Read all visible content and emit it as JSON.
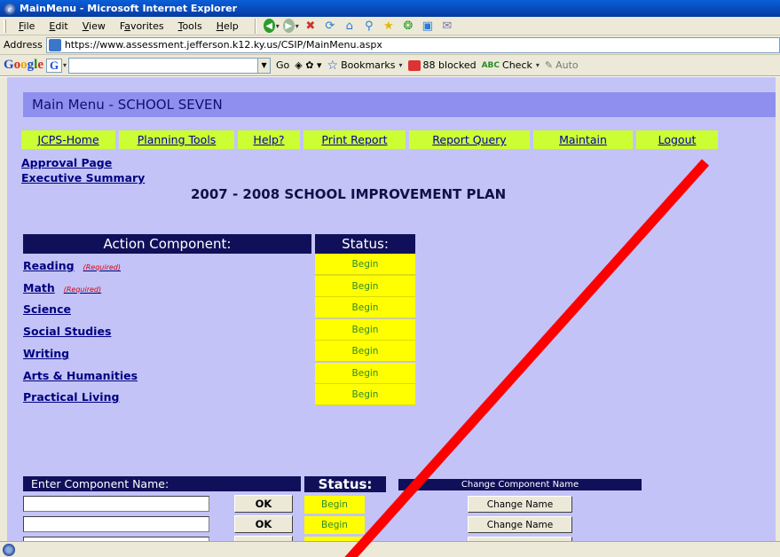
{
  "window": {
    "title": "MainMenu - Microsoft Internet Explorer"
  },
  "menubar": {
    "items": [
      {
        "label": "File",
        "ul": "F",
        "rest": "ile"
      },
      {
        "label": "Edit",
        "ul": "E",
        "rest": "dit"
      },
      {
        "label": "View",
        "ul": "V",
        "rest": "iew"
      },
      {
        "label": "Favorites",
        "pre": "F",
        "ul": "a",
        "rest": "vorites"
      },
      {
        "label": "Tools",
        "ul": "T",
        "rest": "ools"
      },
      {
        "label": "Help",
        "ul": "H",
        "rest": "elp"
      }
    ]
  },
  "address": {
    "label": "Address",
    "url": "https://www.assessment.jefferson.k12.ky.us/CSIP/MainMenu.aspx"
  },
  "google_toolbar": {
    "go": "Go",
    "bookmarks": "Bookmarks",
    "blocked": "88 blocked",
    "check": "Check",
    "autofill": "Auto"
  },
  "page": {
    "header": "Main Menu - SCHOOL SEVEN",
    "nav": [
      "JCPS-Home",
      "Planning Tools",
      "Help?",
      "Print Report",
      "Report Query",
      "Maintain",
      "Logout"
    ],
    "approval_link": "Approval Page",
    "exec_link": "Executive Summary",
    "plan_title": "2007 - 2008 SCHOOL IMPROVEMENT PLAN",
    "action_header": "Action Component:",
    "status_header": "Status:",
    "components": [
      {
        "name": "Reading",
        "required": "(Required)",
        "status": "Begin"
      },
      {
        "name": "Math",
        "required": "(Required)",
        "status": "Begin"
      },
      {
        "name": "Science",
        "required": "",
        "status": "Begin"
      },
      {
        "name": "Social Studies",
        "required": "",
        "status": "Begin"
      },
      {
        "name": "Writing",
        "required": "",
        "status": "Begin"
      },
      {
        "name": "Arts & Humanities",
        "required": "",
        "status": "Begin"
      },
      {
        "name": "Practical Living",
        "required": "",
        "status": "Begin"
      }
    ],
    "enter_header": "Enter Component Name:",
    "status2_header": "Status:",
    "change_header": "Change Component Name",
    "custom_rows": [
      {
        "ok": "OK",
        "status": "Begin",
        "change": "Change Name"
      },
      {
        "ok": "OK",
        "status": "Begin",
        "change": "Change Name"
      }
    ]
  },
  "colors": {
    "content_bg": "#c3c3f8",
    "nav_bg": "#ccff33",
    "status_bg": "#ffff00",
    "header_bg": "#10105a",
    "annotation": "#ff0000"
  }
}
